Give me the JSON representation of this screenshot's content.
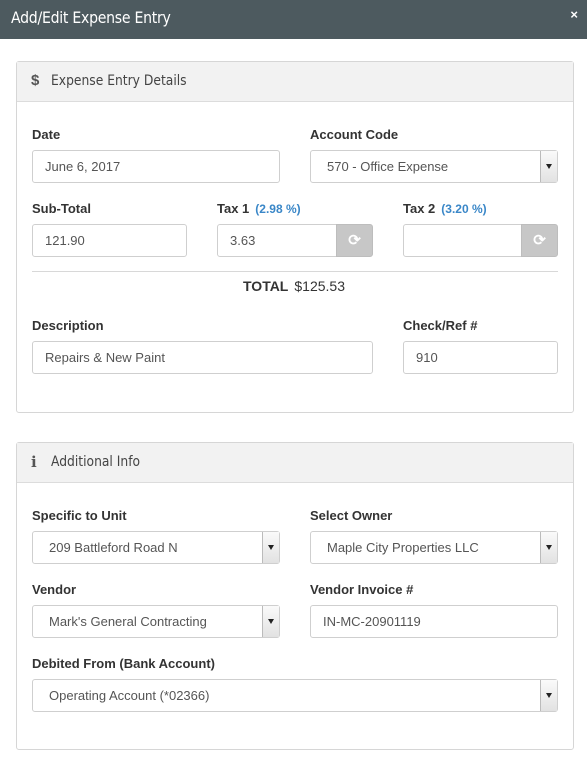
{
  "window": {
    "title": "Add/Edit Expense Entry",
    "close_glyph": "×"
  },
  "details": {
    "heading": "Expense Entry Details",
    "icon": "$",
    "date_label": "Date",
    "date_value": "June 6, 2017",
    "account_label": "Account Code",
    "account_value": "570 - Office Expense",
    "subtotal_label": "Sub-Total",
    "subtotal_value": "121.90",
    "tax1_label": "Tax 1",
    "tax1_rate": "(2.98 %)",
    "tax1_value": "3.63",
    "tax2_label": "Tax 2",
    "tax2_rate": "(3.20 %)",
    "tax2_value": "",
    "total_label": "TOTAL",
    "total_value": "$125.53",
    "description_label": "Description",
    "description_value": "Repairs & New Paint",
    "checkref_label": "Check/Ref #",
    "checkref_value": "910"
  },
  "additional": {
    "heading": "Additional Info",
    "icon": "i",
    "unit_label": "Specific to Unit",
    "unit_value": "209 Battleford Road N",
    "owner_label": "Select Owner",
    "owner_value": "Maple City Properties LLC",
    "vendor_label": "Vendor",
    "vendor_value": "Mark's General Contracting",
    "invoice_label": "Vendor Invoice #",
    "invoice_value": "IN-MC-20901119",
    "bank_label": "Debited From (Bank Account)",
    "bank_value": "Operating Account (*02366)"
  },
  "icons": {
    "refresh": "⟳"
  }
}
